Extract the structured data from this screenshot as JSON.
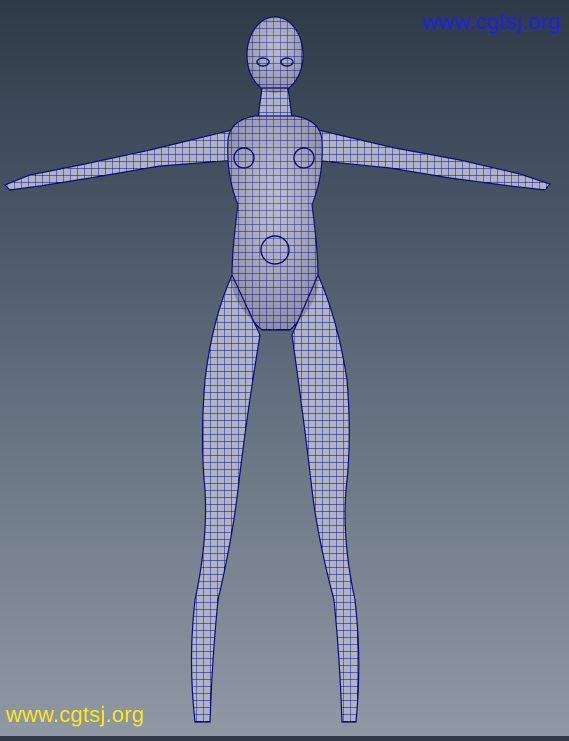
{
  "watermark_top": "www.cgtsj.org",
  "watermark_bottom": "www.cgtsj.org",
  "colors": {
    "mesh_fill": "#aeb3c7",
    "mesh_wire": "#0b0b78",
    "watermark_top": "#1e1ef0",
    "watermark_bottom": "#ffe81a"
  }
}
